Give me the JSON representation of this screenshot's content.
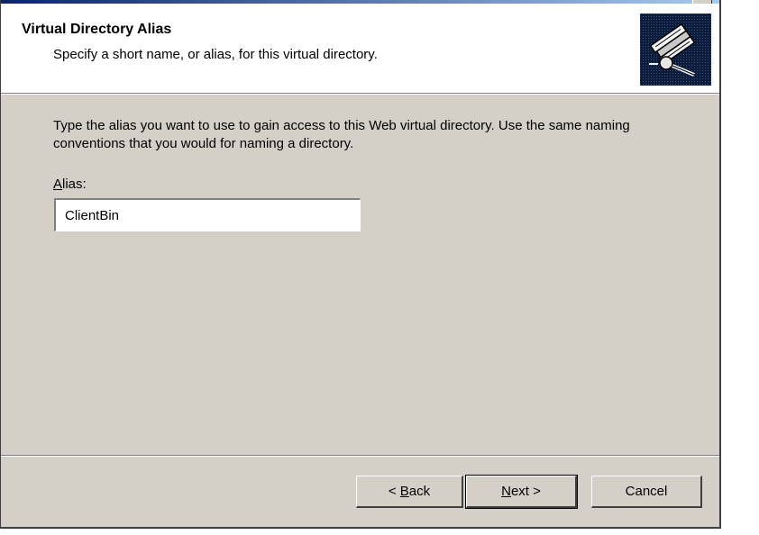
{
  "header": {
    "title": "Virtual Directory Alias",
    "subtitle": "Specify a short name, or alias, for this virtual directory.",
    "icon": "wizard-books-icon"
  },
  "body": {
    "description": "Type the alias you want to use to gain access to this Web virtual directory. Use the same naming conventions that you would for naming a directory.",
    "alias_label_mnemonic": "A",
    "alias_label_rest": "lias:",
    "alias_value": "ClientBin"
  },
  "buttons": {
    "back_prefix": "< ",
    "back_mnemonic": "B",
    "back_rest": "ack",
    "next_mnemonic": "N",
    "next_rest": "ext >",
    "cancel": "Cancel"
  },
  "colors": {
    "dialog_face": "#d4d0c8",
    "header_bg": "#ffffff",
    "icon_bg": "#0c1c3c",
    "title_bar": "#0a246a"
  }
}
